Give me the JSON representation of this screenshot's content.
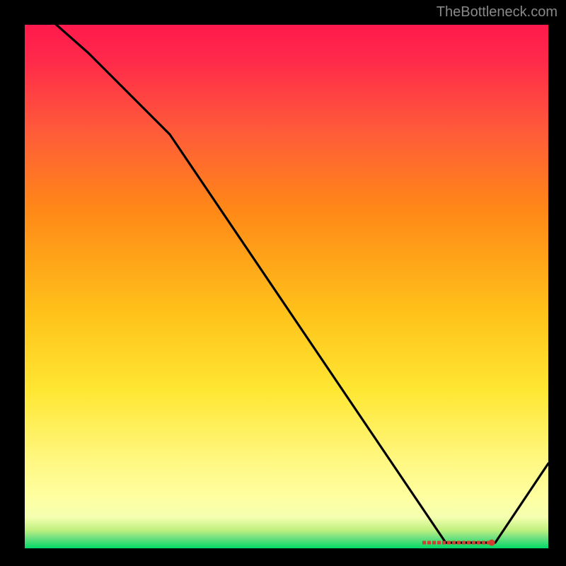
{
  "watermark": "TheBottleneck.com",
  "chart_data": {
    "type": "line",
    "title": "",
    "xlabel": "",
    "ylabel": "",
    "xlim": [
      0,
      100
    ],
    "ylim": [
      0,
      100
    ],
    "x": [
      0,
      10,
      27,
      80,
      90,
      100
    ],
    "values": [
      105,
      95,
      81,
      0,
      0,
      15
    ],
    "background_gradient": {
      "top": "#ff1a4d",
      "mid_top": "#ff8717",
      "mid": "#ffe733",
      "mid_bottom": "#ffffa0",
      "bottom": "#00d966"
    },
    "line_color": "#000000",
    "optimal_marker": {
      "x_range": [
        80,
        90
      ],
      "y": 0,
      "color": "#d04030"
    }
  }
}
